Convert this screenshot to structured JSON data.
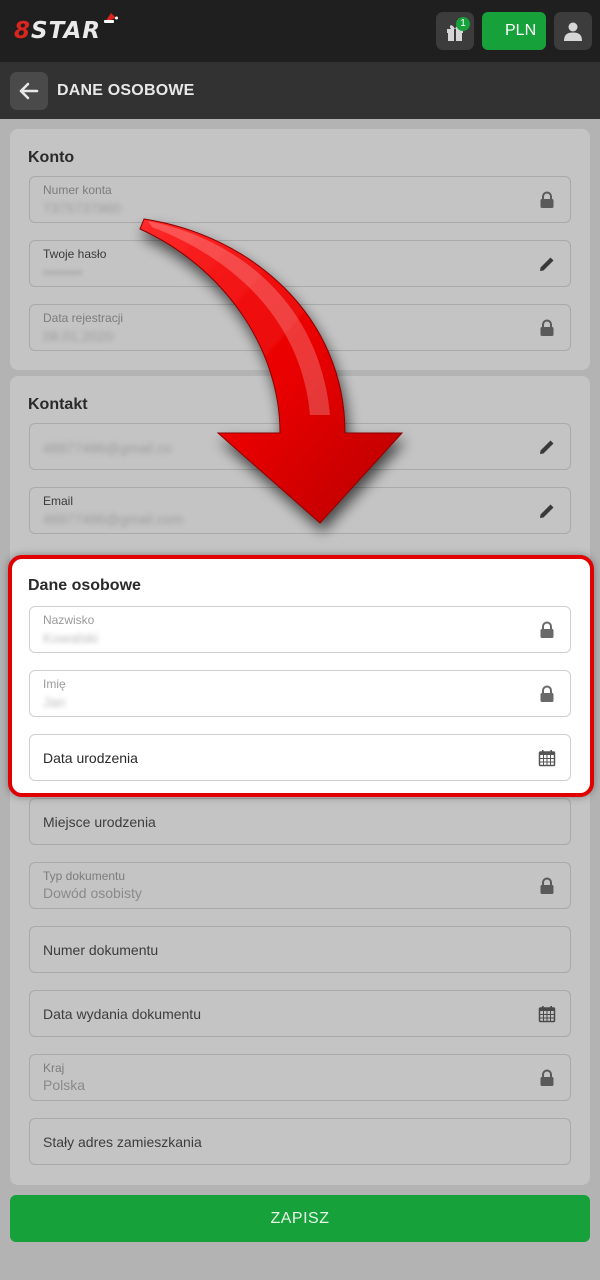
{
  "header": {
    "logo_prefix": "8",
    "logo_text": "STAR",
    "gift_badge": "1",
    "currency": "PLN"
  },
  "page": {
    "title": "DANE OSOBOWE"
  },
  "konto": {
    "title": "Konto",
    "fields": [
      {
        "label": "Numer konta",
        "value": "7375737960",
        "icon": "lock-icon"
      },
      {
        "label": "Twoje hasło",
        "value": "••••••••",
        "icon": "pencil-icon"
      },
      {
        "label": "Data rejestracji",
        "value": "08.01.2020",
        "icon": "lock-icon"
      }
    ]
  },
  "kontakt": {
    "title": "Kontakt",
    "fields": [
      {
        "label": "",
        "value": "48877486@gmail.co",
        "icon": "pencil-icon"
      },
      {
        "label": "Email",
        "value": "48877486@gmail.com",
        "icon": "pencil-icon"
      }
    ]
  },
  "dane_osobowe": {
    "title": "Dane osobowe",
    "fields": [
      {
        "label": "Nazwisko",
        "value": "Kowalski",
        "icon": "lock-icon"
      },
      {
        "label": "Imię",
        "value": "Jan",
        "icon": "lock-icon"
      },
      {
        "label": "",
        "placeholder": "Data urodzenia",
        "icon": "calendar-icon"
      }
    ]
  },
  "more_fields": [
    {
      "placeholder": "Miejsce urodzenia"
    },
    {
      "label": "Typ dokumentu",
      "value": "Dowód osobisty",
      "icon": "lock-icon"
    },
    {
      "placeholder": "Numer dokumentu"
    },
    {
      "placeholder": "Data wydania dokumentu",
      "icon": "calendar-icon"
    },
    {
      "label": "Kraj",
      "value": "Polska",
      "icon": "lock-icon"
    },
    {
      "placeholder": "Stały adres zamieszkania"
    }
  ],
  "save_label": "ZAPISZ",
  "colors": {
    "accent_green": "#17a13a",
    "highlight_red": "#e00000",
    "topbar": "#1f1f1f",
    "overlay_gray": "#b3b3b3"
  }
}
